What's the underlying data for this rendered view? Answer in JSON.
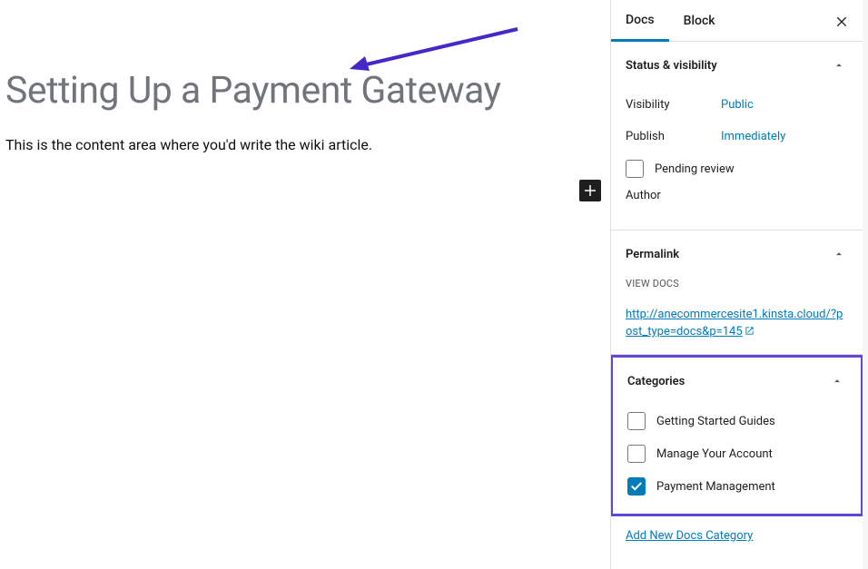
{
  "editor": {
    "title": "Setting Up a Payment Gateway",
    "content": "This is the content area where you'd write the wiki article."
  },
  "sidebar": {
    "tabs": {
      "docs": "Docs",
      "block": "Block"
    },
    "status_panel": {
      "title": "Status & visibility",
      "visibility_label": "Visibility",
      "visibility_value": "Public",
      "publish_label": "Publish",
      "publish_value": "Immediately",
      "pending_review_label": "Pending review",
      "author_label": "Author"
    },
    "permalink_panel": {
      "title": "Permalink",
      "view_docs_label": "VIEW DOCS",
      "url": "http://anecommercesite1.kinsta.cloud/?post_type=docs&p=145"
    },
    "categories_panel": {
      "title": "Categories",
      "items": [
        {
          "label": "Getting Started Guides",
          "checked": false
        },
        {
          "label": "Manage Your Account",
          "checked": false
        },
        {
          "label": "Payment Management",
          "checked": true
        }
      ],
      "add_new_label": "Add New Docs Category"
    }
  }
}
